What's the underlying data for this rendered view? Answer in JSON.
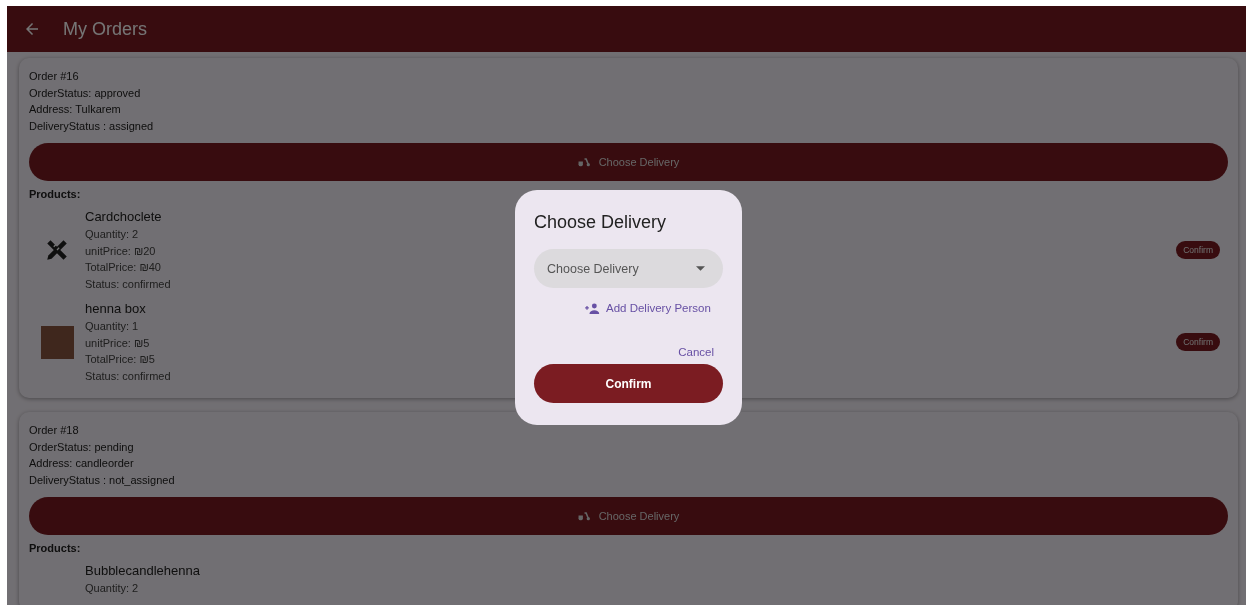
{
  "app_bar": {
    "title": "My Orders"
  },
  "orders": [
    {
      "lines": [
        "Order #16",
        "OrderStatus: approved",
        "Address: Tulkarem",
        "DeliveryStatus : assigned"
      ],
      "delivery_button": "Choose Delivery",
      "products_label": "Products:",
      "products": [
        {
          "kind": "icon",
          "name": "Cardchoclete",
          "details": [
            "Quantity: 2",
            "unitPrice: ₪20",
            "TotalPrice: ₪40",
            "Status: confirmed"
          ],
          "action": "Confirm"
        },
        {
          "kind": "photo",
          "name": "henna box",
          "details": [
            "Quantity: 1",
            "unitPrice: ₪5",
            "TotalPrice: ₪5",
            "Status: confirmed"
          ],
          "action": "Confirm"
        }
      ]
    },
    {
      "lines": [
        "Order #18",
        "OrderStatus: pending",
        "Address: candleorder",
        "DeliveryStatus : not_assigned"
      ],
      "delivery_button": "Choose Delivery",
      "products_label": "Products:",
      "products": [
        {
          "kind": "none",
          "name": "Bubblecandlehenna",
          "details": [
            "Quantity: 2"
          ]
        }
      ]
    }
  ],
  "dialog": {
    "title": "Choose Delivery",
    "dropdown": {
      "placeholder": "Choose Delivery"
    },
    "add_link": "Add Delivery Person",
    "cancel": "Cancel",
    "confirm": "Confirm"
  }
}
